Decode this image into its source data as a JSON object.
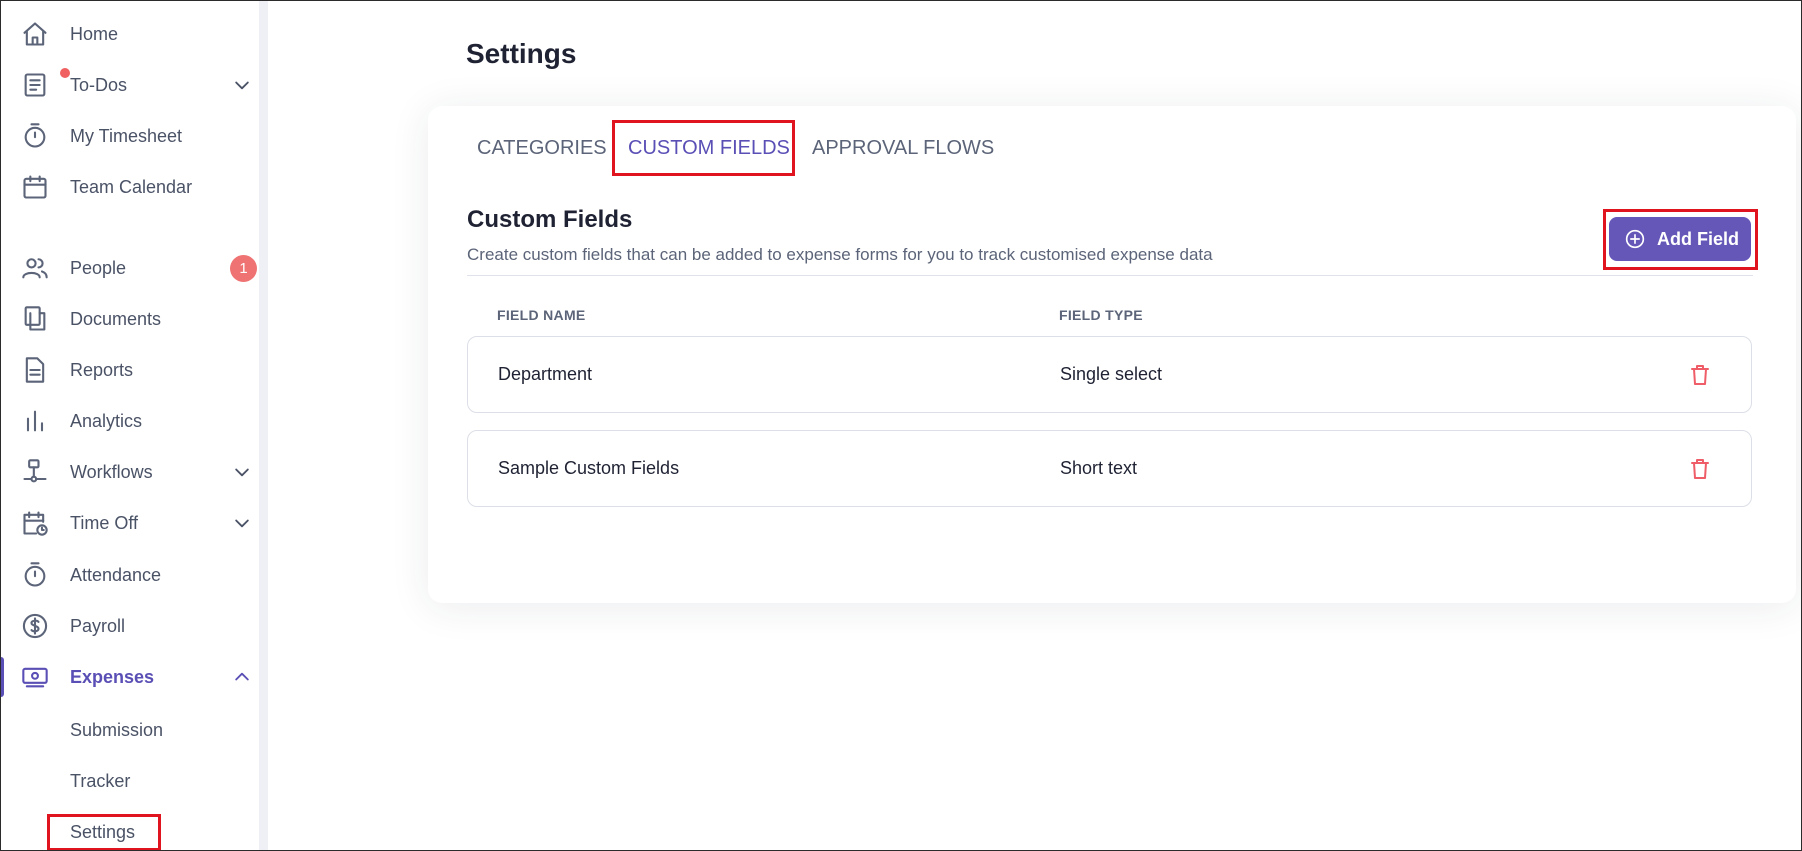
{
  "sidebar": {
    "items": [
      {
        "label": "Home",
        "icon": "home-icon"
      },
      {
        "label": "To-Dos",
        "icon": "todo-list-icon"
      },
      {
        "label": "My Timesheet",
        "icon": "stopwatch-icon"
      },
      {
        "label": "Team Calendar",
        "icon": "calendar-icon"
      },
      {
        "label": "People",
        "icon": "people-icon",
        "badge": "1"
      },
      {
        "label": "Documents",
        "icon": "documents-icon"
      },
      {
        "label": "Reports",
        "icon": "report-icon"
      },
      {
        "label": "Analytics",
        "icon": "bar-chart-icon"
      },
      {
        "label": "Workflows",
        "icon": "workflow-icon"
      },
      {
        "label": "Time Off",
        "icon": "calendar-clock-icon"
      },
      {
        "label": "Attendance",
        "icon": "stopwatch-icon"
      },
      {
        "label": "Payroll",
        "icon": "dollar-coin-icon"
      },
      {
        "label": "Expenses",
        "icon": "money-icon"
      }
    ],
    "expenses_sub": [
      "Submission",
      "Tracker",
      "Settings"
    ]
  },
  "page": {
    "title": "Settings"
  },
  "tabs": [
    "CATEGORIES",
    "CUSTOM FIELDS",
    "APPROVAL FLOWS"
  ],
  "section": {
    "title": "Custom Fields",
    "description": "Create custom fields that can be added to expense forms for you to track customised expense data",
    "add_button": "Add Field"
  },
  "table": {
    "headers": [
      "FIELD NAME",
      "FIELD TYPE"
    ],
    "rows": [
      {
        "name": "Department",
        "type": "Single select"
      },
      {
        "name": "Sample Custom Fields",
        "type": "Short text"
      }
    ]
  },
  "colors": {
    "accent": "#5a4fb5",
    "highlight": "#e0141e",
    "danger": "#ee5d68",
    "badge": "#f07373"
  }
}
